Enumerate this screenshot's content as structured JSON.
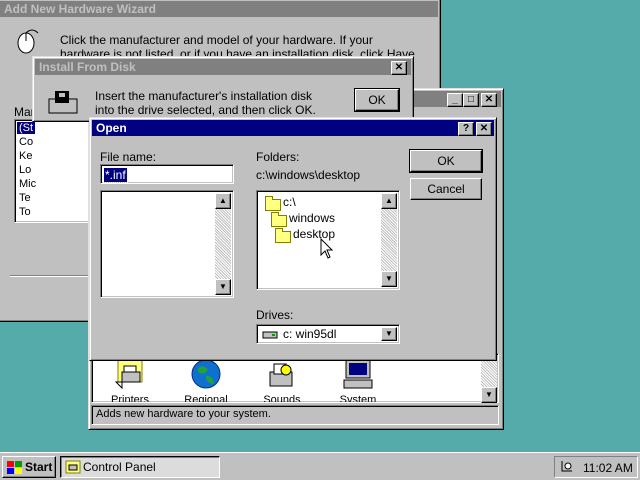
{
  "wizard": {
    "title": "Add New Hardware Wizard",
    "text": "Click the manufacturer and model of your hardware. If your hardware is not listed, or if you have an installation disk, click Have Disk.",
    "manufacturers_label_fragment": "Mar",
    "list_fragments": [
      "(St",
      "Co",
      "Ke",
      "Lo",
      "Mic",
      "Te",
      "To"
    ]
  },
  "install_from_disk": {
    "title": "Install From Disk",
    "text": "Insert the manufacturer's installation disk into the drive selected, and then click OK.",
    "ok_label": "OK",
    "close_glyph": "✕"
  },
  "control_panel": {
    "window_buttons": [
      "_",
      "□",
      "✕"
    ],
    "icons": [
      {
        "label": "Printers",
        "icon": "printers-icon"
      },
      {
        "label": "Regional",
        "icon": "regional-icon"
      },
      {
        "label": "Sounds",
        "icon": "sounds-icon"
      },
      {
        "label": "System",
        "icon": "system-icon"
      }
    ],
    "status": "Adds new hardware to your system."
  },
  "open_dialog": {
    "title": "Open",
    "help_glyph": "?",
    "close_glyph": "✕",
    "file_name_label": "File name:",
    "file_name_value": "*.inf",
    "folders_label": "Folders:",
    "current_path": "c:\\windows\\desktop",
    "folder_tree": [
      "c:\\",
      "windows",
      "desktop"
    ],
    "ok_label": "OK",
    "cancel_label": "Cancel",
    "drives_label": "Drives:",
    "drive_value": "c: win95dl"
  },
  "taskbar": {
    "start_label": "Start",
    "task_label": "Control Panel",
    "clock": "11:02 AM"
  },
  "colors": {
    "desktop": "#55aaaa",
    "active_title": "#000080",
    "inactive_title": "#808080",
    "face": "#c0c0c0"
  }
}
